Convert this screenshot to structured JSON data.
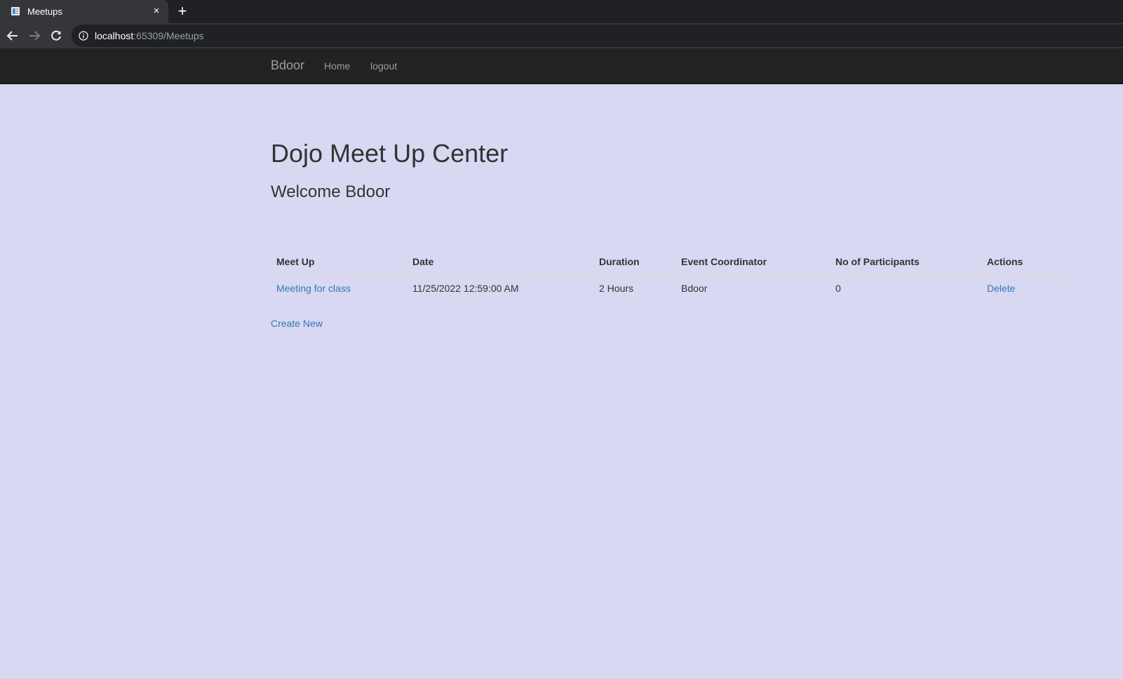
{
  "browser": {
    "tab_title": "Meetups",
    "tab_close": "×",
    "new_tab": "+",
    "url_host": "localhost",
    "url_rest": ":65309/Meetups",
    "icons": {
      "favicon": "page-icon",
      "back": "back-arrow-icon",
      "forward": "forward-arrow-icon",
      "reload": "reload-icon",
      "info": "info-icon"
    }
  },
  "navbar": {
    "brand": "Bdoor",
    "links": [
      "Home",
      "logout"
    ]
  },
  "main": {
    "title": "Dojo Meet Up Center",
    "welcome": "Welcome Bdoor",
    "table": {
      "headers": [
        "Meet Up",
        "Date",
        "Duration",
        "Event Coordinator",
        "No of Participants",
        "Actions"
      ],
      "rows": [
        {
          "meetup": "Meeting for class",
          "date": "11/25/2022 12:59:00 AM",
          "duration": "2 Hours",
          "coordinator": "Bdoor",
          "participants": "0",
          "action": "Delete"
        }
      ]
    },
    "create_new": "Create New"
  },
  "colors": {
    "page_background": "#d8d8f2",
    "navbar_background": "#222222",
    "link": "#337ab7"
  }
}
